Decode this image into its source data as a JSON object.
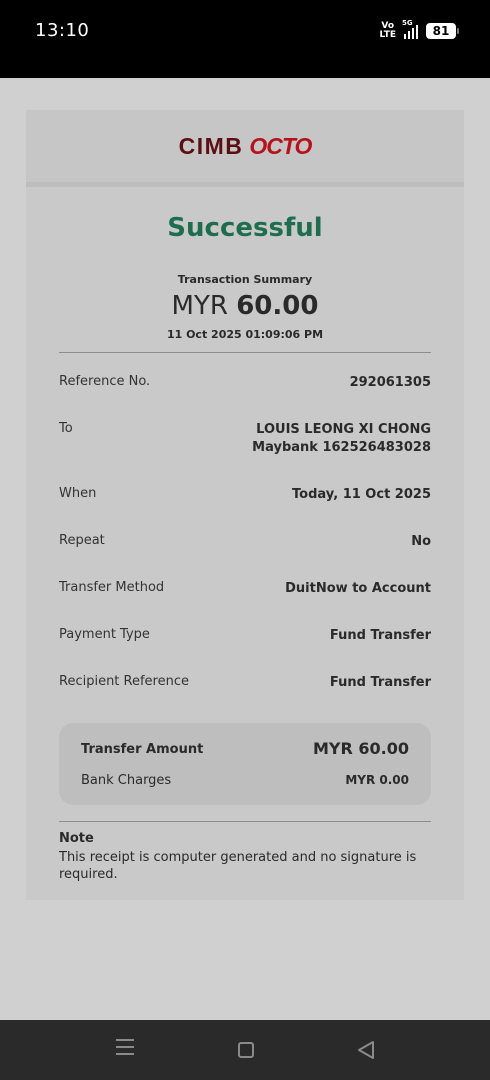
{
  "status_bar": {
    "time": "13:10",
    "volte": "Vo LTE",
    "network": "5G",
    "battery": "81"
  },
  "logo": {
    "part1": "CIMB",
    "part2": "OCTO"
  },
  "receipt": {
    "status": "Successful",
    "summary_label": "Transaction Summary",
    "currency": "MYR",
    "amount": "60.00",
    "datetime": "11 Oct 2025 01:09:06 PM",
    "rows": [
      {
        "label": "Reference No.",
        "value": "292061305"
      },
      {
        "label": "To",
        "value": "LOUIS LEONG XI CHONG",
        "value2": "Maybank 162526483028"
      },
      {
        "label": "When",
        "value": "Today, 11 Oct 2025"
      },
      {
        "label": "Repeat",
        "value": "No"
      },
      {
        "label": "Transfer Method",
        "value": "DuitNow to Account"
      },
      {
        "label": "Payment Type",
        "value": "Fund Transfer"
      },
      {
        "label": "Recipient Reference",
        "value": "Fund Transfer"
      }
    ],
    "totals": {
      "transfer_amount_label": "Transfer Amount",
      "transfer_amount_value": "MYR 60.00",
      "bank_charges_label": "Bank Charges",
      "bank_charges_value": "MYR 0.00"
    },
    "note": {
      "title": "Note",
      "text": "This receipt is computer generated and no signature is required."
    }
  },
  "colors": {
    "success": "#1f6d51",
    "brand_dark": "#5c0f12",
    "brand_red": "#b5121b"
  },
  "nav_icons": [
    "menu-icon",
    "home-icon",
    "back-icon"
  ]
}
